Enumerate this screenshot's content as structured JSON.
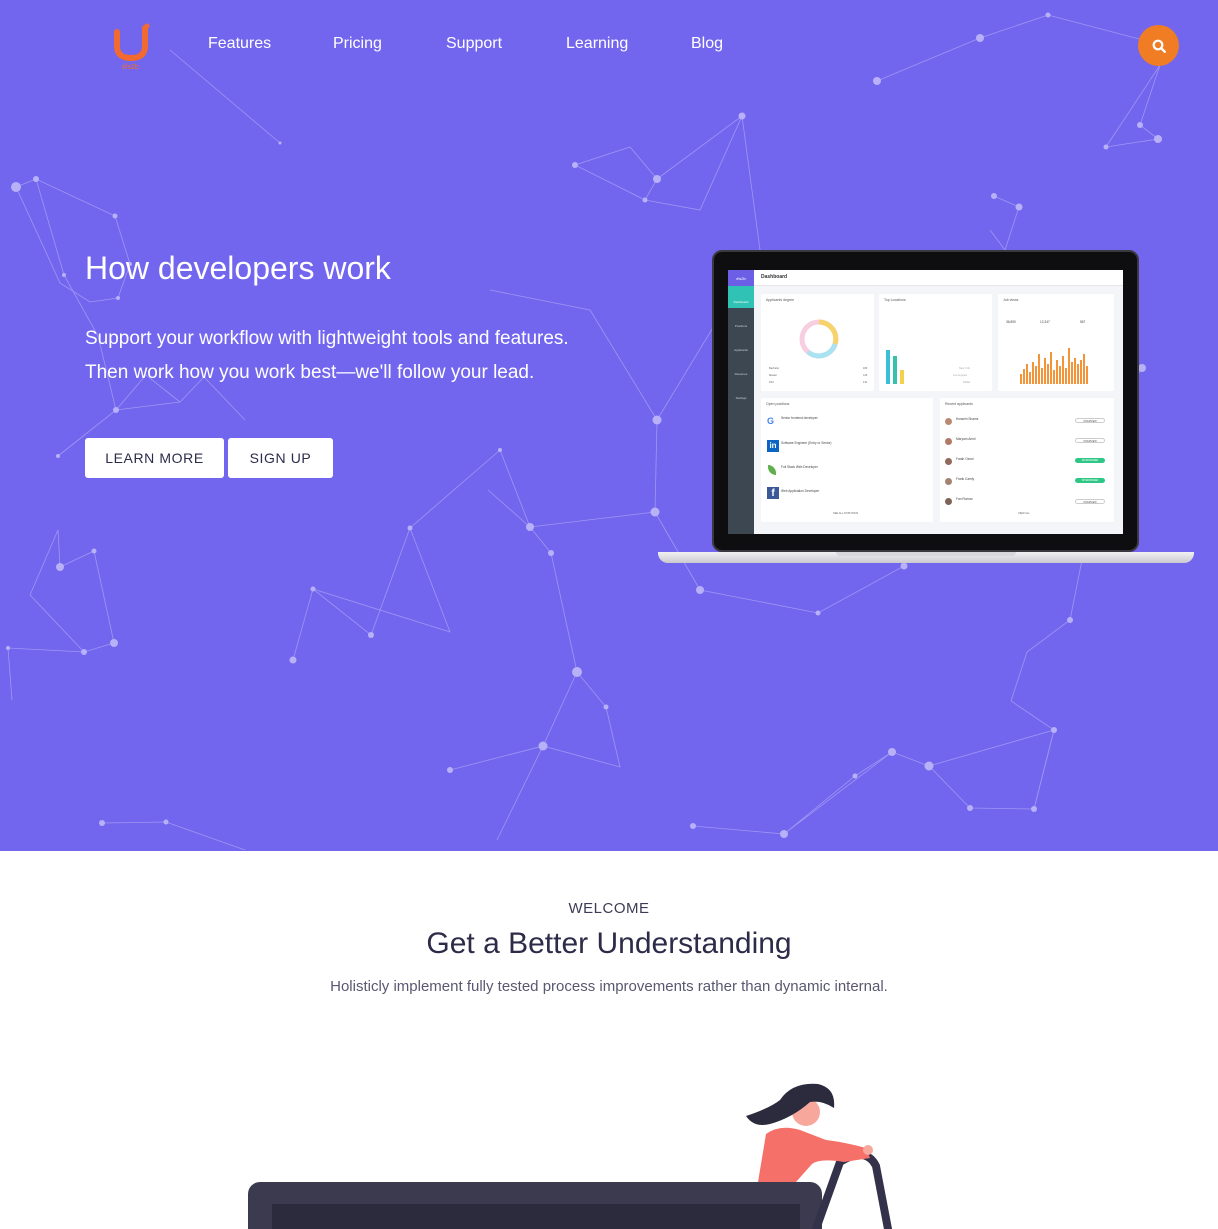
{
  "brand": {
    "logo_text": "éls2b",
    "logo_color": "#f26a2f"
  },
  "nav": {
    "items": [
      "Features",
      "Pricing",
      "Support",
      "Learning",
      "Blog"
    ],
    "search_icon": "search-icon",
    "search_color": "#f07c24"
  },
  "hero": {
    "background": "#7366ee",
    "title": "How developers work",
    "subtitle_line1": "Support your workflow with lightweight tools and features.",
    "subtitle_line2": "Then work how you work best—we'll follow your lead.",
    "learn_more": "LEARN MORE",
    "sign_up": "SIGN UP"
  },
  "dashboard": {
    "brand": "éls2b",
    "title": "Dashboard",
    "sidebar": [
      "Dashboard",
      "Positions",
      "Applicants",
      "Resumes",
      "Settings"
    ],
    "cards": {
      "applicants_degree": "Applicants degree",
      "top_locations": "Top Locations",
      "job_views": "Job views",
      "open_positions": "Open positions",
      "recent_applicants": "Recent applicants"
    },
    "degree_legend": [
      {
        "label": "Bachelor",
        "value": "183"
      },
      {
        "label": "Master",
        "value": "415"
      },
      {
        "label": "Phd",
        "value": "131"
      }
    ],
    "locations_legend": [
      "New York",
      "Los Angeles",
      "Dallas"
    ],
    "job_views_stats": [
      {
        "value": "36,890",
        "label": "all time"
      },
      {
        "value": "12,347",
        "label": "applicants"
      },
      {
        "value": "567",
        "label": "today"
      }
    ],
    "positions": [
      {
        "title": "Senior frontend developer",
        "company": "Google",
        "icon": "google-icon"
      },
      {
        "title": "Software Engineer (Entry or Senior)",
        "company": "LinkedIn",
        "icon": "linkedin-icon"
      },
      {
        "title": "Full Stack Web Developer",
        "company": "Leaf",
        "icon": "leaf-icon"
      },
      {
        "title": "Web Application Developer",
        "company": "Facebook",
        "icon": "facebook-icon"
      }
    ],
    "see_all_positions": "SEE ALL POSITIONS",
    "applicants": [
      {
        "name": "Hossein Shams",
        "status": "INTERVIEW"
      },
      {
        "name": "Maryam Amiri",
        "status": "INTERVIEW"
      },
      {
        "name": "Farah Oeoni",
        "status": "INTERVIEWED"
      },
      {
        "name": "Frank Camly",
        "status": "INTERVIEWED"
      },
      {
        "name": "Fan Romao",
        "status": "INTERVIEW"
      }
    ],
    "view_all": "VIEW ALL"
  },
  "welcome": {
    "eyebrow": "WELCOME",
    "title": "Get a Better Understanding",
    "subtitle": "Holisticly implement fully tested process improvements rather than dynamic internal."
  }
}
